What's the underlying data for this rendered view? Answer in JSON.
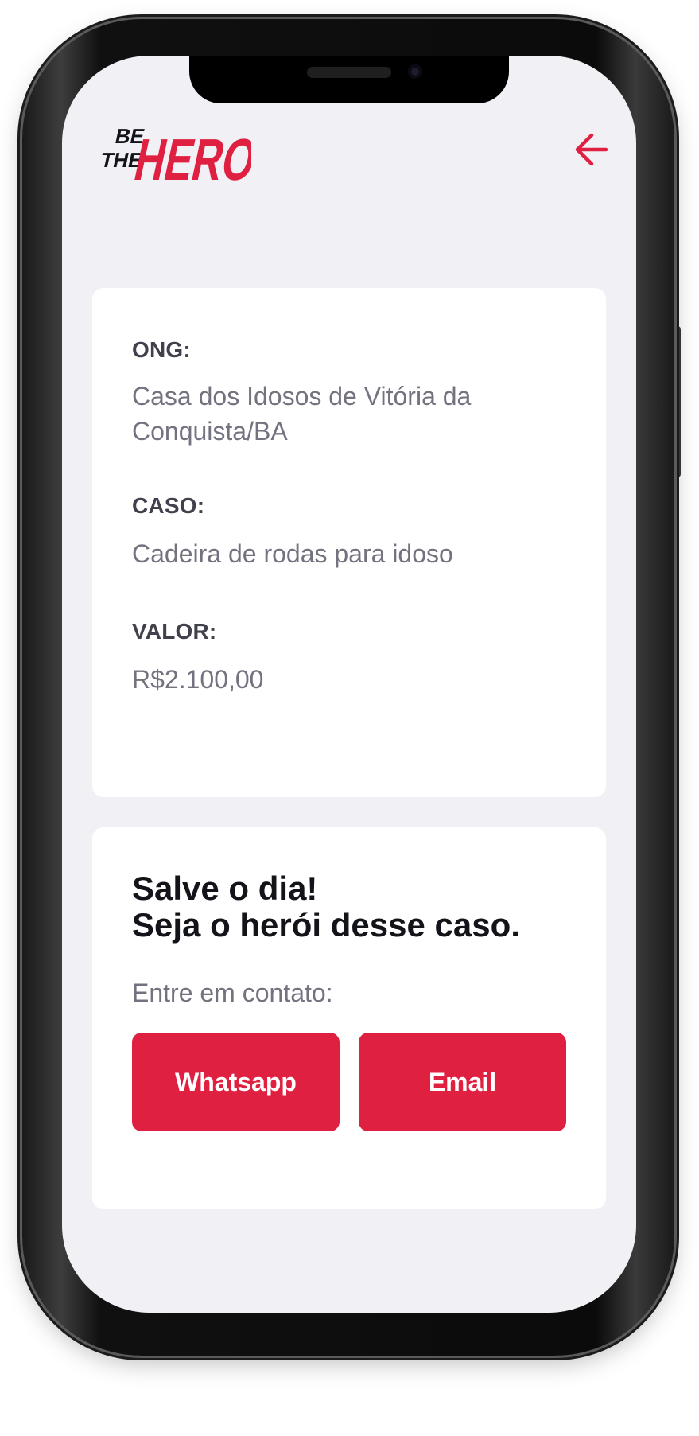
{
  "header": {
    "logo_top": "BE",
    "logo_middle": "THE",
    "logo_main": "HERO",
    "back_icon": "arrow-left-icon"
  },
  "incident": {
    "ong_label": "ONG:",
    "ong_value": "Casa dos Idosos de Vitória da Conquista/BA",
    "case_label": "CASO:",
    "case_value": "Cadeira de rodas para idoso",
    "value_label": "VALOR:",
    "value_value": "R$2.100,00"
  },
  "contact": {
    "title_line1": "Salve o dia!",
    "title_line2": "Seja o herói desse caso.",
    "hint": "Entre em contato:",
    "whatsapp_label": "Whatsapp",
    "email_label": "Email"
  },
  "colors": {
    "brand": "#e02041",
    "background": "#f0f0f5",
    "card": "#ffffff",
    "label": "#41414d",
    "text": "#737380",
    "title": "#13131a"
  }
}
